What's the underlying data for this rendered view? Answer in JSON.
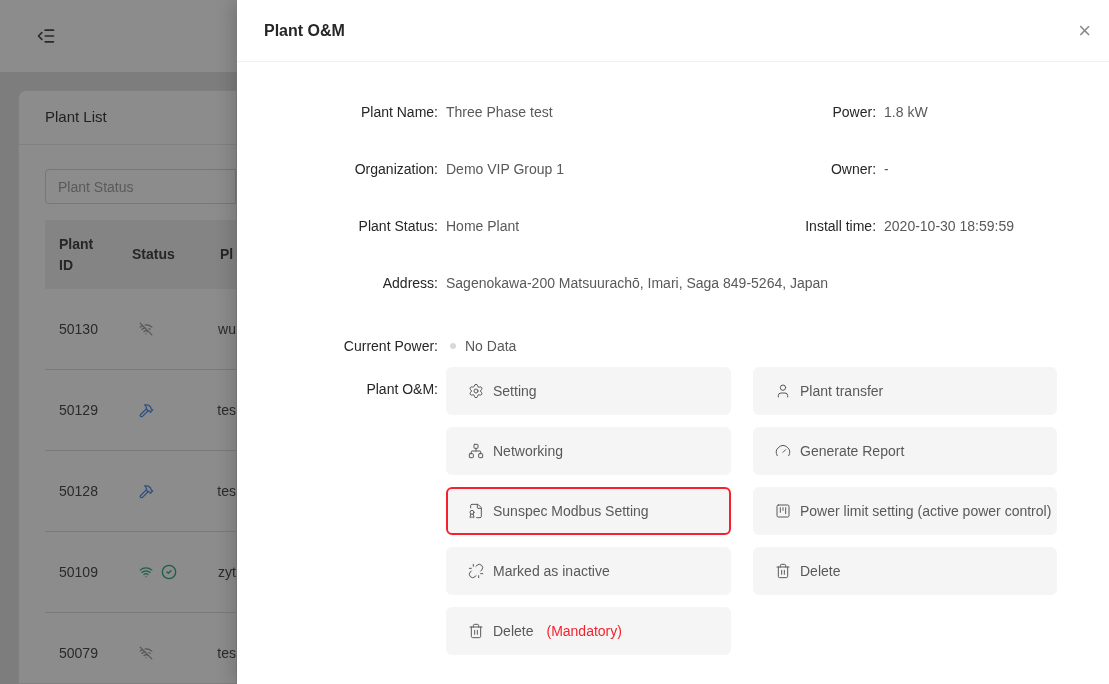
{
  "background": {
    "list_title": "Plant List",
    "filter": {
      "placeholder": "Plant Status"
    },
    "columns": [
      "Plant ID",
      "Status",
      "Pl"
    ],
    "rows": [
      {
        "id": "50130",
        "status_icons": [
          {
            "kind": "offline"
          }
        ],
        "column_3": "wu"
      },
      {
        "id": "50129",
        "status_icons": [
          {
            "kind": "construction"
          }
        ],
        "column_3": "tes"
      },
      {
        "id": "50128",
        "status_icons": [
          {
            "kind": "construction"
          }
        ],
        "column_3": "tes"
      },
      {
        "id": "50109",
        "status_icons": [
          {
            "kind": "online"
          },
          {
            "kind": "ok"
          }
        ],
        "column_3": "zyt"
      },
      {
        "id": "50079",
        "status_icons": [
          {
            "kind": "offline"
          }
        ],
        "column_3": "tes"
      }
    ]
  },
  "drawer": {
    "title": "Plant O&M",
    "close": "×",
    "left_fields": [
      {
        "label": "Plant Name:",
        "value": "Three Phase test"
      },
      {
        "label": "Organization:",
        "value": "Demo VIP Group 1"
      },
      {
        "label": "Plant Status:",
        "value": "Home Plant"
      }
    ],
    "right_fields": [
      {
        "label": "Power:",
        "value": "1.8 kW"
      },
      {
        "label": "Owner:",
        "value": "-"
      },
      {
        "label": "Install time:",
        "value": "2020-10-30 18:59:59"
      }
    ],
    "address": {
      "label": "Address:",
      "value": "Sagenokawa-200 Matsuurachō, Imari, Saga 849-5264, Japan"
    },
    "current_power": {
      "label": "Current Power:",
      "value": "No Data",
      "color": "#d9d9d9"
    },
    "om_label": "Plant O&M:",
    "actions": [
      {
        "kind": "gear",
        "label": "Setting",
        "highlighted": false
      },
      {
        "kind": "user",
        "label": "Plant transfer",
        "highlighted": false
      },
      {
        "kind": "network",
        "label": "Networking",
        "highlighted": false
      },
      {
        "kind": "gauge",
        "label": "Generate Report",
        "highlighted": false
      },
      {
        "kind": "document",
        "label": "Sunspec Modbus Setting",
        "highlighted": true
      },
      {
        "kind": "board",
        "label": "Power limit setting (active power control)",
        "highlighted": false
      },
      {
        "kind": "unlink",
        "label": "Marked as inactive",
        "highlighted": false
      },
      {
        "kind": "trash",
        "label": "Delete",
        "highlighted": false
      },
      {
        "kind": "trash",
        "label": "Delete",
        "suffix": "(Mandatory)",
        "highlighted": false
      }
    ]
  }
}
